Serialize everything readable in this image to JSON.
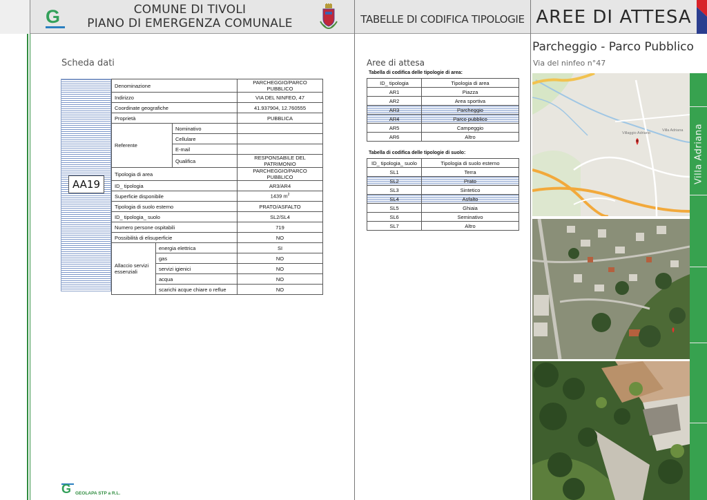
{
  "header": {
    "title_line1": "COMUNE DI TIVOLI",
    "title_line2": "PIANO DI EMERGENZA COMUNALE",
    "section_tab": "TABELLE DI CODIFICA TIPOLOGIE",
    "section_main": "AREE DI ATTESA",
    "logo_letter": "G"
  },
  "scheda": {
    "title": "Scheda dati",
    "code": "AA19",
    "rows": {
      "denominazione": {
        "label": "Denominazione",
        "value": "PARCHEGGIO/PARCO PUBBLICO"
      },
      "indirizzo": {
        "label": "Indirizzo",
        "value": "VIA DEL NINFEO, 47"
      },
      "coordinate": {
        "label": "Coordinate geografiche",
        "value": "41.937904, 12.760555"
      },
      "proprieta": {
        "label": "Proprietà",
        "value": "PUBBLICA"
      },
      "referente": {
        "label": "Referente"
      },
      "nominativo": {
        "label": "Nominativo",
        "value": ""
      },
      "cellulare": {
        "label": "Cellulare",
        "value": ""
      },
      "email": {
        "label": "E-mail",
        "value": ""
      },
      "qualifica": {
        "label": "Qualifica",
        "value": "RESPONSABILE DEL PATRIMONIO"
      },
      "tipologia_area": {
        "label": "Tipologia di area",
        "value": "PARCHEGGIO/PARCO PUBBLICO"
      },
      "id_tipologia": {
        "label": "ID_ tipologia",
        "value": "AR3/AR4"
      },
      "superficie": {
        "label": "Superficie disponibile",
        "value": "1439 m",
        "unit_sup": "2"
      },
      "tipologia_suolo": {
        "label": "Tipologia di suolo esterno",
        "value": "PRATO/ASFALTO"
      },
      "id_tipologia_suolo": {
        "label": "ID_ tipologia_ suolo",
        "value": "SL2/SL4"
      },
      "persone": {
        "label": "Numero persone ospitabili",
        "value": "719"
      },
      "elisuperficie": {
        "label": "Possibilità di elisuperficie",
        "value": "NO"
      },
      "allaccio": {
        "label": "Allaccio servizi essenziali"
      },
      "energia": {
        "label": "energia elettrica",
        "value": "SI"
      },
      "gas": {
        "label": "gas",
        "value": "NO"
      },
      "servizi_igienici": {
        "label": "servizi igienici",
        "value": "NO"
      },
      "acqua": {
        "label": "acqua",
        "value": "NO"
      },
      "scarichi": {
        "label": "scarichi acque chiare o reflue",
        "value": "NO"
      }
    }
  },
  "codifica": {
    "title": "Aree di attesa",
    "area_table": {
      "caption": "Tabella di codifica delle tipologie di area:",
      "headers": [
        "ID_ tipologia",
        "Tipologia di area"
      ],
      "rows": [
        {
          "id": "AR1",
          "name": "Piazza",
          "highlight": false
        },
        {
          "id": "AR2",
          "name": "Area sportiva",
          "highlight": false
        },
        {
          "id": "AR3",
          "name": "Parcheggio",
          "highlight": true
        },
        {
          "id": "AR4",
          "name": "Parco pubblico",
          "highlight": true
        },
        {
          "id": "AR5",
          "name": "Campeggio",
          "highlight": false
        },
        {
          "id": "AR6",
          "name": "Altro",
          "highlight": false
        }
      ]
    },
    "suolo_table": {
      "caption": "Tabella di codifica delle tipologie di suolo:",
      "headers": [
        "ID_ tipologia_ suolo",
        "Tipologia di suolo esterno"
      ],
      "rows": [
        {
          "id": "SL1",
          "name": "Terra",
          "highlight": false
        },
        {
          "id": "SL2",
          "name": "Prato",
          "highlight": true
        },
        {
          "id": "SL3",
          "name": "Sintetico",
          "highlight": false
        },
        {
          "id": "SL4",
          "name": "Asfalto",
          "highlight": true
        },
        {
          "id": "SL5",
          "name": "Ghiaia",
          "highlight": false
        },
        {
          "id": "SL6",
          "name": "Seminativo",
          "highlight": false
        },
        {
          "id": "SL7",
          "name": "Altro",
          "highlight": false
        }
      ]
    }
  },
  "site": {
    "name": "Parcheggio - Parco Pubblico",
    "address": "Via del ninfeo n°47",
    "side_label": "Villa Adriana",
    "map_label_village": "Villaggio Adriano",
    "map_label_villa": "Villa Adriana"
  },
  "footer": {
    "company": "GEOLAPA STP  a R.L."
  },
  "colors": {
    "accent_green": "#37a24f",
    "stripe_blue": "#7b96c8",
    "flag_red": "#d8232a",
    "flag_blue": "#2b3e8f"
  }
}
